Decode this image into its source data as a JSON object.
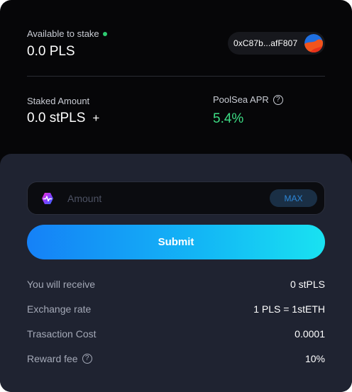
{
  "wallet_summary": {
    "available_label": "Available to stake",
    "available_value": "0.0 PLS",
    "wallet_address": "0xC87b...afF807",
    "staked_label": "Staked Amount",
    "staked_value": "0.0 stPLS",
    "add_icon": "+",
    "apr_label": "PoolSea APR",
    "apr_value": "5.4%",
    "help_icon": "?",
    "colors": {
      "online": "#2ecc71",
      "apr": "#3ddc84"
    }
  },
  "stake_form": {
    "amount_placeholder": "Amount",
    "amount_value": "",
    "max_label": "MAX",
    "submit_label": "Submit",
    "token_icon": "pulsechain-logo-icon",
    "colors": {
      "submit_gradient_start": "#1581f7",
      "submit_gradient_end": "#19e2f1",
      "max_text": "#2d86d6"
    }
  },
  "details": [
    {
      "label": "You will receive",
      "value": "0 stPLS",
      "help": false
    },
    {
      "label": "Exchange rate",
      "value": "1 PLS = 1stETH",
      "help": false
    },
    {
      "label": "Trasaction Cost",
      "value": "0.0001",
      "help": false
    },
    {
      "label": "Reward fee",
      "value": "10%",
      "help": true
    }
  ]
}
